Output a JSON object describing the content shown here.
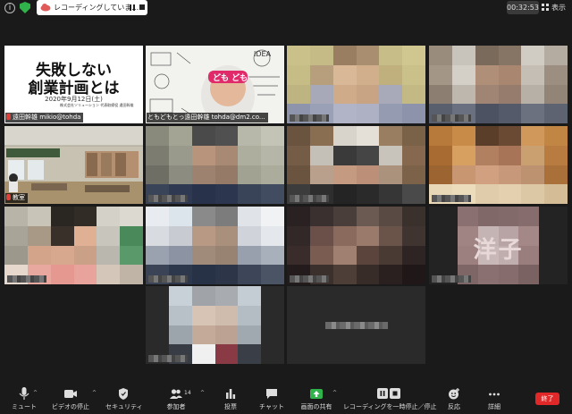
{
  "topbar": {
    "recording_text": "レコーディングしていま…",
    "timer": "00:32:53",
    "view_label": "表示"
  },
  "tiles": {
    "slide": {
      "title_line1": "失敗しない",
      "title_line2": "創業計画とは",
      "date": "2020年9月12日(土)",
      "footer": "株式会社ソリューション 代表取締役 遠田幹雄",
      "name": "遠田幹雄 mikio@tohda"
    },
    "presenter": {
      "name": "ともどもとっ遠田幹雄 tohda@dm2.co..."
    },
    "classroom": {
      "name": "教室"
    },
    "placeholder_name_char": "洋子"
  },
  "toolbar": {
    "items": [
      {
        "label": "ミュート",
        "icon": "microphone-icon"
      },
      {
        "label": "ビデオの停止",
        "icon": "video-camera-icon"
      },
      {
        "label": "セキュリティ",
        "icon": "shield-icon"
      },
      {
        "label": "参加者",
        "icon": "participants-icon",
        "count": "14"
      },
      {
        "label": "投票",
        "icon": "poll-icon"
      },
      {
        "label": "チャット",
        "icon": "chat-icon"
      },
      {
        "label": "画面の共有",
        "icon": "share-screen-icon"
      },
      {
        "label": "レコーディングを一時停止／停止",
        "icon": "recording-pause-icon"
      },
      {
        "label": "反応",
        "icon": "reaction-icon"
      },
      {
        "label": "詳細",
        "icon": "more-icon"
      }
    ],
    "end_label": "終了"
  },
  "colors": {
    "share_green": "#2fb34a",
    "end_red": "#e02828",
    "active_speaker": "#c8e04a"
  }
}
